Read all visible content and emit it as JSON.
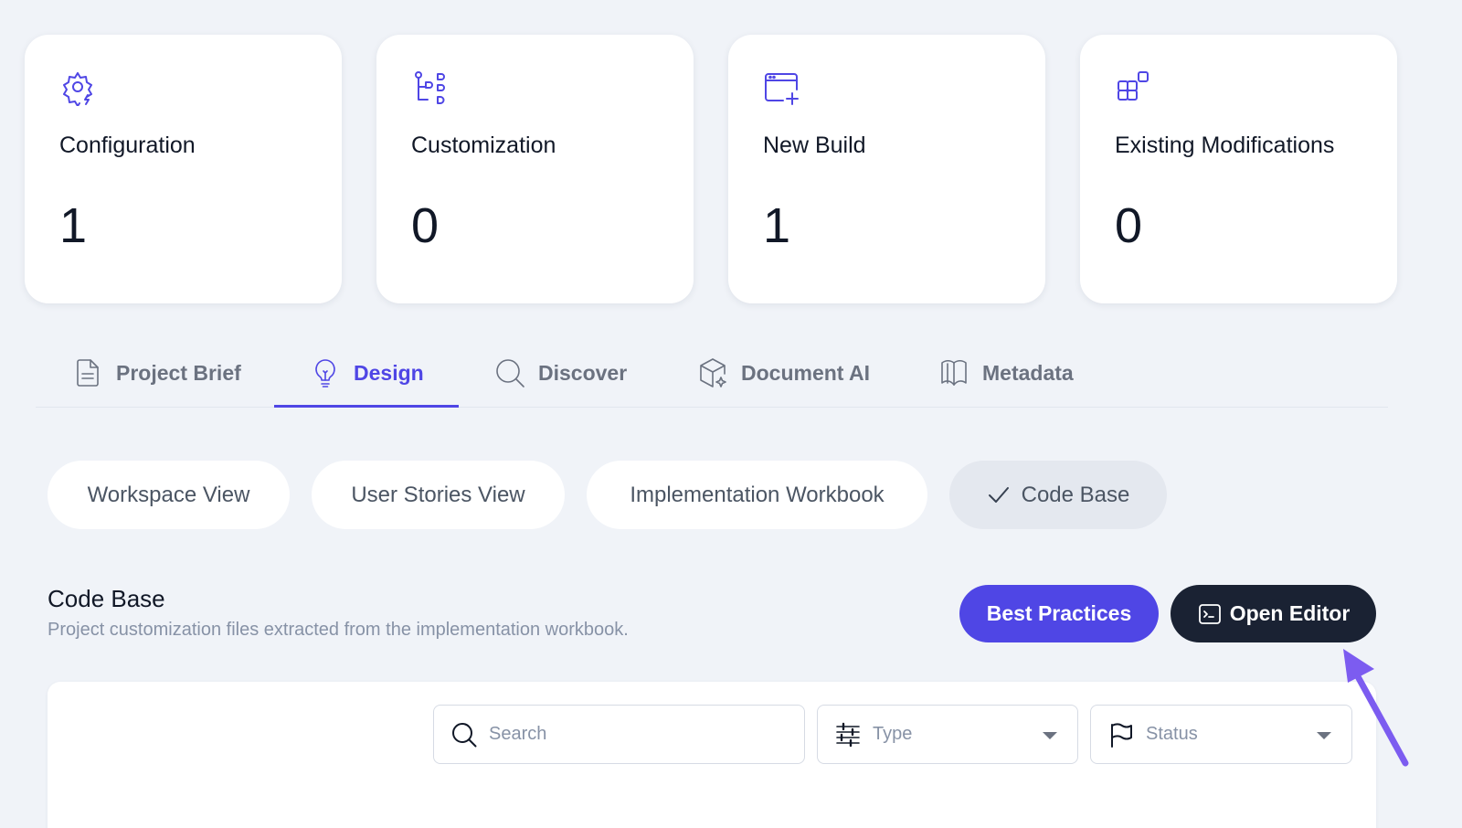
{
  "cards": [
    {
      "title": "Configuration",
      "value": "1",
      "icon": "gear-bolt-icon"
    },
    {
      "title": "Customization",
      "value": "0",
      "icon": "workflow-icon"
    },
    {
      "title": "New Build",
      "value": "1",
      "icon": "window-plus-icon"
    },
    {
      "title": "Existing Modifications",
      "value": "0",
      "icon": "blocks-icon"
    }
  ],
  "tabs": [
    {
      "label": "Project Brief",
      "icon": "document-icon",
      "active": false
    },
    {
      "label": "Design",
      "icon": "lightbulb-icon",
      "active": true
    },
    {
      "label": "Discover",
      "icon": "search-icon",
      "active": false
    },
    {
      "label": "Document AI",
      "icon": "cube-sparkle-icon",
      "active": false
    },
    {
      "label": "Metadata",
      "icon": "book-icon",
      "active": false
    }
  ],
  "views": [
    {
      "label": "Workspace View",
      "selected": false
    },
    {
      "label": "User Stories View",
      "selected": false
    },
    {
      "label": "Implementation Workbook",
      "selected": false
    },
    {
      "label": "Code Base",
      "selected": true
    }
  ],
  "section": {
    "title": "Code Base",
    "subtitle": "Project customization files extracted from the implementation workbook.",
    "best_practices_label": "Best Practices",
    "open_editor_label": "Open Editor"
  },
  "filters": {
    "search_placeholder": "Search",
    "type_label": "Type",
    "status_label": "Status"
  },
  "colors": {
    "accent": "#4f46e5",
    "dark_button": "#1a2233",
    "background": "#f0f3f8",
    "annotation_arrow": "#7c5cf0"
  }
}
